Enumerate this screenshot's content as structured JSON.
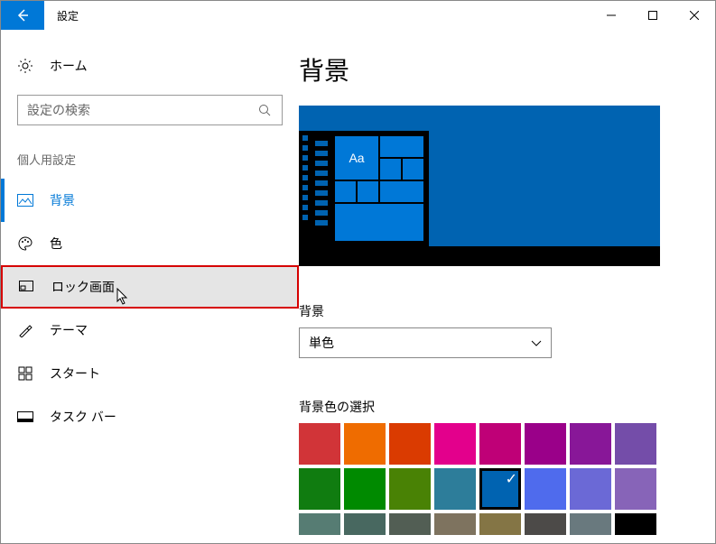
{
  "titlebar": {
    "title": "設定"
  },
  "sidebar": {
    "home": "ホーム",
    "search_placeholder": "設定の検索",
    "section": "個人用設定",
    "items": [
      {
        "label": "背景"
      },
      {
        "label": "色"
      },
      {
        "label": "ロック画面"
      },
      {
        "label": "テーマ"
      },
      {
        "label": "スタート"
      },
      {
        "label": "タスク バー"
      }
    ]
  },
  "main": {
    "title": "背景",
    "preview_tile_label": "Aa",
    "bg_label": "背景",
    "bg_value": "単色",
    "color_label": "背景色の選択",
    "colors_row1": [
      "#d13438",
      "#ef6c00",
      "#da3b01",
      "#e3008c",
      "#bf0077",
      "#9a0089",
      "#881798",
      "#744da9"
    ],
    "colors_row2": [
      "#107c10",
      "#008a00",
      "#498205",
      "#2d7d9a",
      "#0063b1",
      "#4f6bed",
      "#6b69d6",
      "#8764b8"
    ],
    "colors_row3": [
      "#567c73",
      "#486860",
      "#525e54",
      "#7e735f",
      "#847545",
      "#4c4a48",
      "#69797e",
      "#000000"
    ],
    "selected_index": 12
  }
}
